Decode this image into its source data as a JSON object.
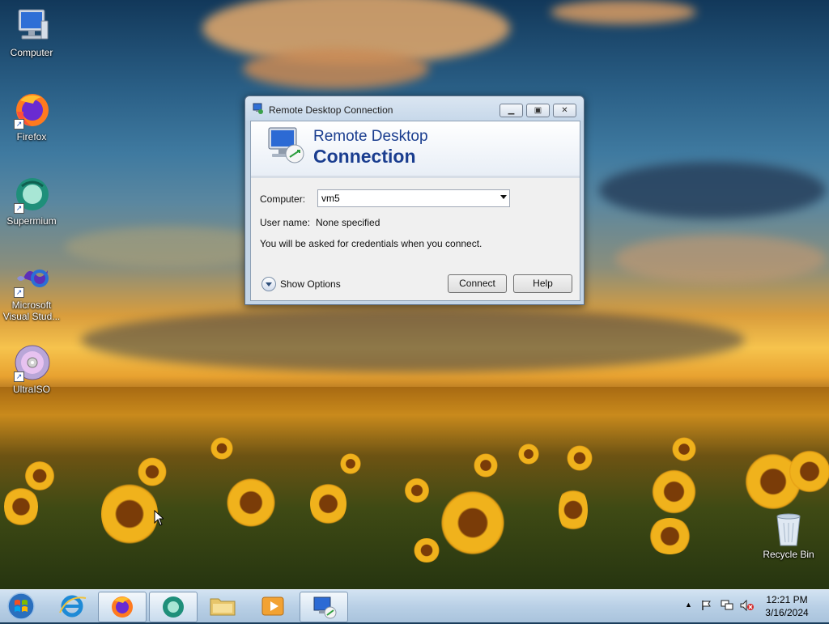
{
  "desktop": {
    "icons": [
      {
        "label": "Computer"
      },
      {
        "label": "Firefox"
      },
      {
        "label": "Supermium"
      },
      {
        "label": "Microsoft Visual Stud..."
      },
      {
        "label": "UltraISO"
      },
      {
        "label": "Recycle Bin"
      }
    ]
  },
  "window": {
    "title": "Remote Desktop Connection",
    "banner_line1": "Remote Desktop",
    "banner_line2": "Connection",
    "computer_label": "Computer:",
    "computer_value": "vm5",
    "username_label": "User name:",
    "username_value": "None specified",
    "info_text": "You will be asked for credentials when you connect.",
    "show_options": "Show Options",
    "connect_button": "Connect",
    "help_button": "Help"
  },
  "taskbar": {
    "apps": [
      "Internet Explorer",
      "Firefox",
      "Supermium",
      "File Explorer",
      "Media Player",
      "Remote Desktop Connection"
    ],
    "tray_icons": [
      "chevron-up-icon",
      "flag-icon",
      "network-icon",
      "volume-muted-icon"
    ],
    "time": "12:21 PM",
    "date": "3/16/2024"
  }
}
